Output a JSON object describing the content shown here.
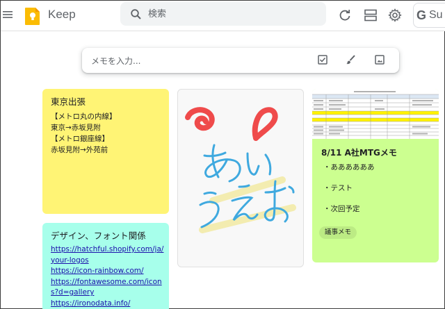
{
  "header": {
    "app_name": "Keep",
    "search_placeholder": "検索",
    "account_initial": "G",
    "account_label_partial": "Su"
  },
  "take_note": {
    "placeholder": "メモを入力..."
  },
  "notes": [
    {
      "color": "#fff475",
      "title": "東京出張",
      "lines": [
        "【メトロ丸の内線】",
        "東京→赤坂見附",
        "【メトロ銀座線】",
        "赤坂見附→外苑前"
      ]
    },
    {
      "color": "#a7ffeb",
      "title": "デザイン、フォント関係",
      "lines": [
        "https://hatchful.shopify.com/ja/",
        "your-logos",
        "https://icon-rainbow.com/",
        "https://fontawesome.com/icon",
        "s?d=gallery",
        "https://ironodata.info/"
      ]
    },
    {
      "color": "#f8f8f8",
      "type": "drawing",
      "handwriting": "あいうえお"
    },
    {
      "color": "#ccff90",
      "title": "8/11 A社MTGメモ",
      "bullets": [
        "・ああああああ",
        "・テスト",
        "・次回予定"
      ],
      "label": "議事メモ"
    }
  ]
}
